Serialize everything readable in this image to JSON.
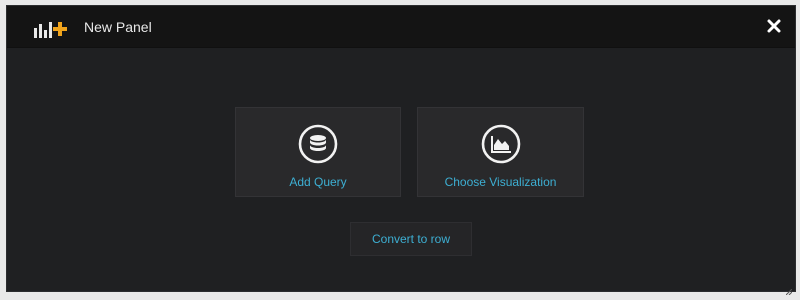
{
  "header": {
    "title": "New Panel",
    "logo_icon": "add-panel-icon",
    "close_icon": "close-icon"
  },
  "actions": [
    {
      "label": "Add Query",
      "icon": "database-icon"
    },
    {
      "label": "Choose Visualization",
      "icon": "area-chart-icon"
    }
  ],
  "convert_button": {
    "label": "Convert to row"
  },
  "colors": {
    "accent": "#3dafd3",
    "logo_accent": "#f0a41c",
    "panel_bg": "#1f2022",
    "header_bg": "#141414",
    "tile_bg": "#29292b"
  }
}
